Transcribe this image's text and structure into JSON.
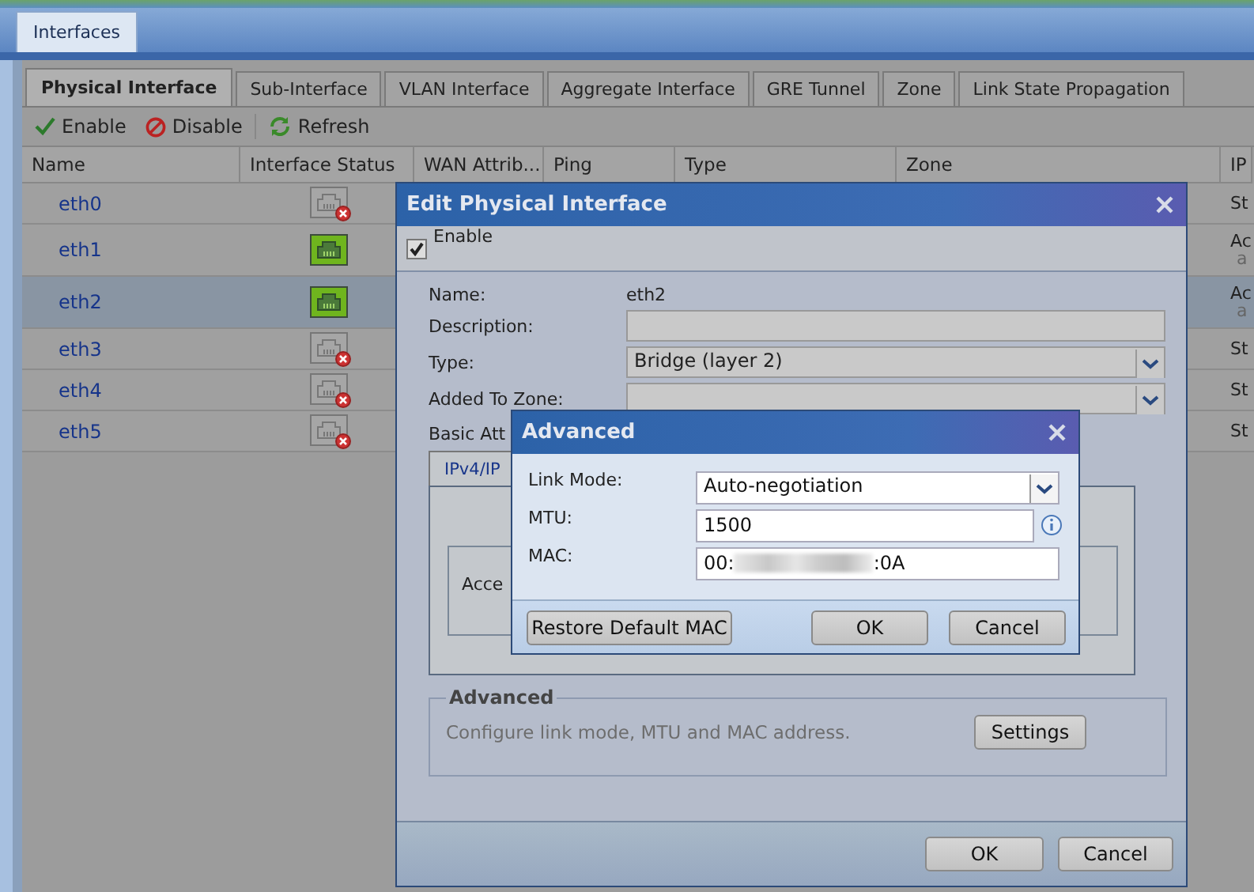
{
  "main_tab": {
    "label": "Interfaces",
    "selected": true
  },
  "tabs": [
    {
      "label": "Physical Interface",
      "selected": true
    },
    {
      "label": "Sub-Interface",
      "selected": false
    },
    {
      "label": "VLAN Interface",
      "selected": false
    },
    {
      "label": "Aggregate Interface",
      "selected": false
    },
    {
      "label": "GRE Tunnel",
      "selected": false
    },
    {
      "label": "Zone",
      "selected": false
    },
    {
      "label": "Link State Propagation",
      "selected": false
    }
  ],
  "toolbar": [
    {
      "label": "Enable",
      "kind": "enable"
    },
    {
      "label": "Disable",
      "kind": "disable"
    },
    {
      "label": "Refresh",
      "kind": "refresh"
    }
  ],
  "table": {
    "columns": [
      "Name",
      "Interface Status",
      "WAN Attrib...",
      "Ping",
      "Type",
      "Zone",
      "IP"
    ],
    "rows": [
      {
        "name": "eth0",
        "connected": false,
        "selected": false,
        "ip": "St"
      },
      {
        "name": "eth1",
        "connected": true,
        "selected": false,
        "ip": "Ac",
        "ip_sub": "a"
      },
      {
        "name": "eth2",
        "connected": true,
        "selected": true,
        "ip": "Ac",
        "ip_sub": "a"
      },
      {
        "name": "eth3",
        "connected": false,
        "selected": false,
        "ip": "St"
      },
      {
        "name": "eth4",
        "connected": false,
        "selected": false,
        "ip": "St"
      },
      {
        "name": "eth5",
        "connected": false,
        "selected": false,
        "ip": "St"
      }
    ]
  },
  "edit_dialog": {
    "title": "Edit Physical Interface",
    "enable": {
      "label": "Enable",
      "checked": true
    },
    "fields": [
      {
        "label": "Name:",
        "kind": "text",
        "value": "eth2"
      },
      {
        "label": "Description:",
        "kind": "input"
      },
      {
        "label": "Type:",
        "kind": "select",
        "value": "Bridge (layer 2)"
      },
      {
        "label": "Added To Zone:",
        "kind": "select"
      }
    ],
    "section_label": "Basic Att",
    "subtab": {
      "label": "IPv4/IP",
      "selected": true
    },
    "inner_text": "Acce",
    "advanced": {
      "legend": "Advanced",
      "description": "Configure link mode, MTU and MAC address.",
      "button": "Settings"
    },
    "buttons": [
      "OK",
      "Cancel"
    ]
  },
  "advanced_dialog": {
    "title": "Advanced",
    "link_mode": {
      "label": "Link Mode:",
      "value": "Auto-negotiation"
    },
    "mtu": {
      "label": "MTU:",
      "value": "1500"
    },
    "mac": {
      "label": "MAC:",
      "start": "00:",
      "end": ":0A"
    },
    "buttons": [
      "Restore Default MAC",
      "OK",
      "Cancel"
    ]
  }
}
